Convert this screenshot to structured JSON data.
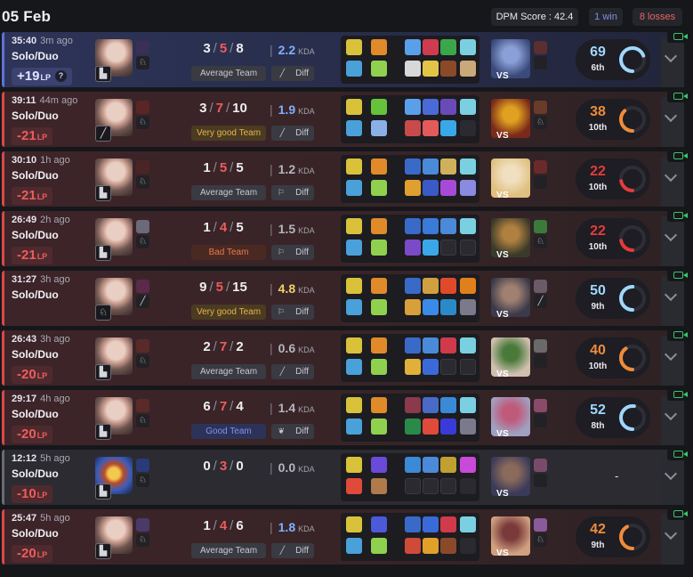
{
  "header": {
    "date": "05 Feb",
    "dpm_score": "DPM Score : 42.4",
    "wins": "1 win",
    "losses": "8 losses"
  },
  "colors": {
    "win": "#5f72d8",
    "loss": "#d94848",
    "win_lp": "#dfe4ff",
    "loss_lp": "#ee5c5c"
  },
  "matches": [
    {
      "result": "win",
      "time": "35:40",
      "ago": "3m ago",
      "queue": "Solo/Duo",
      "lp": "+19",
      "lp_unit": "LP",
      "lp_help": "?",
      "k": "3",
      "d": "5",
      "a": "8",
      "kda": "2.2",
      "kda_label": "KDA",
      "kda_color": "#7fb0ff",
      "team": "Average Team",
      "team_style": "avg",
      "diff": "Diff",
      "diff_icon": "slash",
      "champ": "singed",
      "badge": "▙",
      "minis": [
        "#3b2f55",
        "♘"
      ],
      "vs": "VS",
      "vs_colors": [
        "#3a4a7a",
        "#8ba0d8"
      ],
      "vs_minis": [
        "#5a2f2f",
        ""
      ],
      "score": "69",
      "rank": "6th",
      "score_pct": 0.69,
      "score_color": "#9fd7ff",
      "items": [
        "#d9c23a",
        "#e08a2a",
        "#5aa0e8",
        "#cf3b4f",
        "#3aa84a",
        "#7ad0e0",
        "#4aa0d8",
        "#8fd14f",
        "#d8d8d8",
        "#e2c547",
        "#8a4a2a",
        "#c9a87a"
      ]
    },
    {
      "result": "loss",
      "time": "39:11",
      "ago": "44m ago",
      "queue": "Solo/Duo",
      "lp": "-21",
      "lp_unit": "LP",
      "k": "3",
      "d": "7",
      "a": "10",
      "kda": "1.9",
      "kda_label": "KDA",
      "kda_color": "#7fb0ff",
      "team": "Very good Team",
      "team_style": "vgood",
      "diff": "Diff",
      "diff_icon": "slash",
      "champ": "singed",
      "badge": "╱",
      "minis": [
        "#5a2525",
        "♘"
      ],
      "vs": "VS",
      "vs_colors": [
        "#7a2a1a",
        "#e0a020"
      ],
      "vs_minis": [
        "#6a3a2a",
        "♘"
      ],
      "score": "38",
      "rank": "10th",
      "score_pct": 0.38,
      "score_color": "#ef8c3a",
      "items": [
        "#d9c23a",
        "#66c23a",
        "#5aa0e8",
        "#4a6ad8",
        "#6a4ab8",
        "#7ad0e0",
        "#4aa0d8",
        "#8ab0e8",
        "#c84a4a",
        "#e25a5a",
        "#3aa8e8",
        "#2a2a30"
      ]
    },
    {
      "result": "loss",
      "time": "30:10",
      "ago": "1h ago",
      "queue": "Solo/Duo",
      "lp": "-21",
      "lp_unit": "LP",
      "k": "1",
      "d": "5",
      "a": "5",
      "kda": "1.2",
      "kda_label": "KDA",
      "kda_color": "#b5b5bf",
      "team": "Average Team",
      "team_style": "avg",
      "diff": "Diff",
      "diff_icon": "flag",
      "champ": "singed",
      "badge": "▙",
      "minis": [
        "#4a2525",
        "♘"
      ],
      "vs": "VS",
      "vs_colors": [
        "#e0c080",
        "#f0e0c0"
      ],
      "vs_minis": [
        "#6a2a2a",
        ""
      ],
      "score": "22",
      "rank": "10th",
      "score_pct": 0.22,
      "score_color": "#e33b3b",
      "items": [
        "#d9c23a",
        "#e08a2a",
        "#3a6ac8",
        "#4a8ad8",
        "#d0b05a",
        "#7ad0e0",
        "#4aa0d8",
        "#8fd14f",
        "#e0a030",
        "#3a5ac8",
        "#a84ad8",
        "#8a8ae0"
      ]
    },
    {
      "result": "loss",
      "time": "26:49",
      "ago": "2h ago",
      "queue": "Solo/Duo",
      "lp": "-21",
      "lp_unit": "LP",
      "k": "1",
      "d": "4",
      "a": "5",
      "kda": "1.5",
      "kda_label": "KDA",
      "kda_color": "#b5b5bf",
      "team": "Bad Team",
      "team_style": "bad",
      "diff": "Diff",
      "diff_icon": "flag",
      "champ": "singed",
      "badge": "▙",
      "minis": [
        "#6a6a7a",
        "♘"
      ],
      "vs": "VS",
      "vs_colors": [
        "#3a3a2a",
        "#b08040"
      ],
      "vs_minis": [
        "#3a7a3a",
        "♘"
      ],
      "score": "22",
      "rank": "10th",
      "score_pct": 0.22,
      "score_color": "#e33b3b",
      "items": [
        "#d9c23a",
        "#e08a2a",
        "#3a6ac8",
        "#3a7ad8",
        "#4a8ad8",
        "#7ad0e0",
        "#4aa0d8",
        "#8fd14f",
        "#7a4ac8",
        "#3aa8e8",
        "empty",
        "empty"
      ]
    },
    {
      "result": "loss",
      "time": "31:27",
      "ago": "3h ago",
      "queue": "Solo/Duo",
      "lp": "",
      "lp_unit": "",
      "k": "9",
      "d": "5",
      "a": "15",
      "kda": "4.8",
      "kda_label": "KDA",
      "kda_color": "#f0cf6a",
      "team": "Very good Team",
      "team_style": "vgood",
      "diff": "Diff",
      "diff_icon": "flag",
      "champ": "singed",
      "badge": "♘",
      "minis": [
        "#5a2a4a",
        "╱"
      ],
      "vs": "VS",
      "vs_colors": [
        "#3a3a4a",
        "#a08070"
      ],
      "vs_minis": [
        "#6a5a6a",
        "╱"
      ],
      "score": "50",
      "rank": "9th",
      "score_pct": 0.5,
      "score_color": "#9fd7ff",
      "items": [
        "#d9c23a",
        "#e08a2a",
        "#3a6ac8",
        "#d0a040",
        "#e04a2a",
        "#e0801a",
        "#4aa0d8",
        "#8fd14f",
        "#d8a03a",
        "#3a8ae8",
        "#2a8ac8",
        "#7a7a8a"
      ]
    },
    {
      "result": "loss",
      "time": "26:43",
      "ago": "3h ago",
      "queue": "Solo/Duo",
      "lp": "-20",
      "lp_unit": "LP",
      "k": "2",
      "d": "7",
      "a": "2",
      "kda": "0.6",
      "kda_label": "KDA",
      "kda_color": "#b5b5bf",
      "team": "Average Team",
      "team_style": "avg",
      "diff": "Diff",
      "diff_icon": "slash",
      "champ": "singed",
      "badge": "▙",
      "minis": [
        "#5a2a2a",
        "♘"
      ],
      "vs": "VS",
      "vs_colors": [
        "#d0c0b0",
        "#4a7a3a"
      ],
      "vs_minis": [
        "#6a6a6a",
        ""
      ],
      "score": "40",
      "rank": "10th",
      "score_pct": 0.4,
      "score_color": "#ef8c3a",
      "items": [
        "#d9c23a",
        "#e08a2a",
        "#3a6ac8",
        "#4a8ad8",
        "#d03a4a",
        "#7ad0e0",
        "#4aa0d8",
        "#8fd14f",
        "#e0b03a",
        "#3a6ad8",
        "empty",
        "empty"
      ]
    },
    {
      "result": "loss",
      "time": "29:17",
      "ago": "4h ago",
      "queue": "Solo/Duo",
      "lp": "-20",
      "lp_unit": "LP",
      "k": "6",
      "d": "7",
      "a": "4",
      "kda": "1.4",
      "kda_label": "KDA",
      "kda_color": "#b5b5bf",
      "team": "Good Team",
      "team_style": "good",
      "diff": "Diff",
      "diff_icon": "leaf",
      "champ": "singed",
      "badge": "▙",
      "minis": [
        "#5a2a2a",
        "♘"
      ],
      "vs": "VS",
      "vs_colors": [
        "#a0a0c0",
        "#c05a7a"
      ],
      "vs_minis": [
        "#8a4a6a",
        ""
      ],
      "score": "52",
      "rank": "8th",
      "score_pct": 0.52,
      "score_color": "#9fd7ff",
      "items": [
        "#d9c23a",
        "#e08a2a",
        "#8a3a4a",
        "#4a6ac8",
        "#3a8ad8",
        "#7ad0e0",
        "#4aa0d8",
        "#8fd14f",
        "#2a8a4a",
        "#e04a3a",
        "#3a3ad8",
        "#7a7a8a"
      ]
    },
    {
      "result": "remake",
      "time": "12:12",
      "ago": "5h ago",
      "queue": "Solo/Duo",
      "lp": "-10",
      "lp_unit": "LP",
      "k": "0",
      "d": "3",
      "a": "0",
      "kda": "0.0",
      "kda_label": "KDA",
      "kda_color": "#b5b5bf",
      "team": "",
      "team_style": "",
      "diff": "",
      "diff_icon": "",
      "champ": "heimer",
      "badge": "▙",
      "minis": [
        "#2a3a7a",
        "♘"
      ],
      "vs": "VS",
      "vs_colors": [
        "#3a3a5a",
        "#8a6a5a"
      ],
      "vs_minis": [
        "#7a4a6a",
        ""
      ],
      "score": "-",
      "rank": "",
      "score_pct": 0,
      "score_color": "#e8e8ee",
      "items": [
        "#d9c23a",
        "#6a4ad8",
        "#3a8ad8",
        "#4a8ad8",
        "#c0a030",
        "#c84ad8",
        "#e04a3a",
        "#b07a4a",
        "empty",
        "empty",
        "empty",
        "#2a2a30"
      ]
    },
    {
      "result": "loss",
      "time": "25:47",
      "ago": "5h ago",
      "queue": "Solo/Duo",
      "lp": "-20",
      "lp_unit": "LP",
      "k": "1",
      "d": "4",
      "a": "6",
      "kda": "1.8",
      "kda_label": "KDA",
      "kda_color": "#7fb0ff",
      "team": "Average Team",
      "team_style": "avg",
      "diff": "Diff",
      "diff_icon": "slash",
      "champ": "singed",
      "badge": "▙",
      "minis": [
        "#4a3a6a",
        "♘"
      ],
      "vs": "VS",
      "vs_colors": [
        "#d0a080",
        "#7a3a3a"
      ],
      "vs_minis": [
        "#8a5a9a",
        "♘"
      ],
      "score": "42",
      "rank": "9th",
      "score_pct": 0.42,
      "score_color": "#ef8c3a",
      "items": [
        "#d9c23a",
        "#4a5ad8",
        "#3a6ac8",
        "#3a6ad8",
        "#d03a4a",
        "#7ad0e0",
        "#4aa0d8",
        "#8fd14f",
        "#d04a3a",
        "#e0a02a",
        "#8a4a2a",
        "#2a2a30"
      ]
    }
  ]
}
